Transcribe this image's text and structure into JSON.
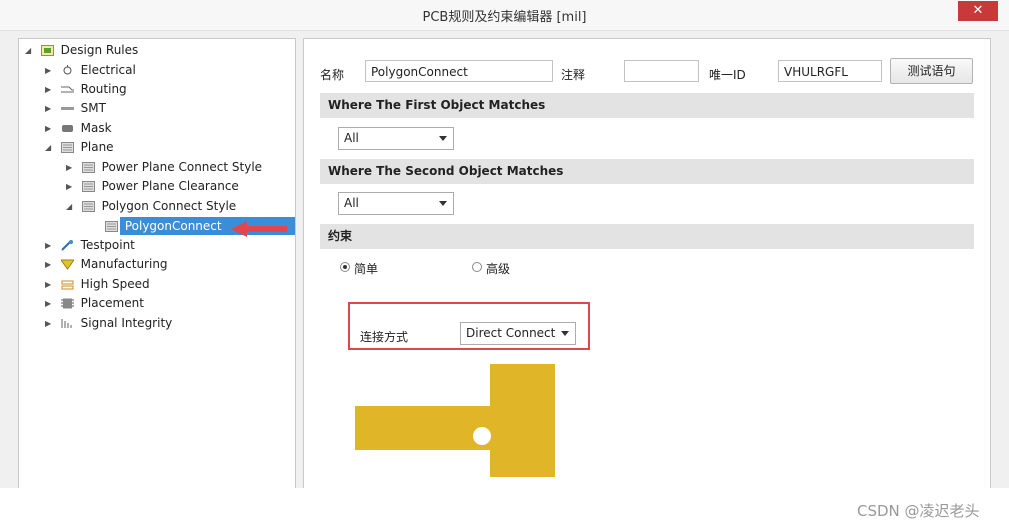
{
  "window": {
    "title": "PCB规则及约束编辑器 [mil]",
    "close_label": "✕"
  },
  "tree": {
    "root": "Design Rules",
    "items": [
      {
        "label": "Electrical"
      },
      {
        "label": "Routing"
      },
      {
        "label": "SMT"
      },
      {
        "label": "Mask"
      },
      {
        "label": "Plane"
      },
      {
        "label": "Power Plane Connect Style"
      },
      {
        "label": "Power Plane Clearance"
      },
      {
        "label": "Polygon Connect Style"
      },
      {
        "label": "PolygonConnect"
      },
      {
        "label": "Testpoint"
      },
      {
        "label": "Manufacturing"
      },
      {
        "label": "High Speed"
      },
      {
        "label": "Placement"
      },
      {
        "label": "Signal Integrity"
      }
    ]
  },
  "form": {
    "name_label": "名称",
    "name_value": "PolygonConnect",
    "comment_label": "注释",
    "comment_value": "",
    "uid_label": "唯一ID",
    "uid_value": "VHULRGFL",
    "test_button": "测试语句",
    "first_match_header": "Where The First Object Matches",
    "first_match_value": "All",
    "second_match_header": "Where The Second Object Matches",
    "second_match_value": "All",
    "constraint_header": "约束",
    "radio_simple": "简单",
    "radio_advanced": "高级",
    "connect_label": "连接方式",
    "connect_value": "Direct Connect"
  },
  "colors": {
    "accent": "#3c8dd7",
    "highlight": "#e0464a",
    "copper": "#e0b628"
  },
  "watermark": "CSDN @凌迟老头"
}
